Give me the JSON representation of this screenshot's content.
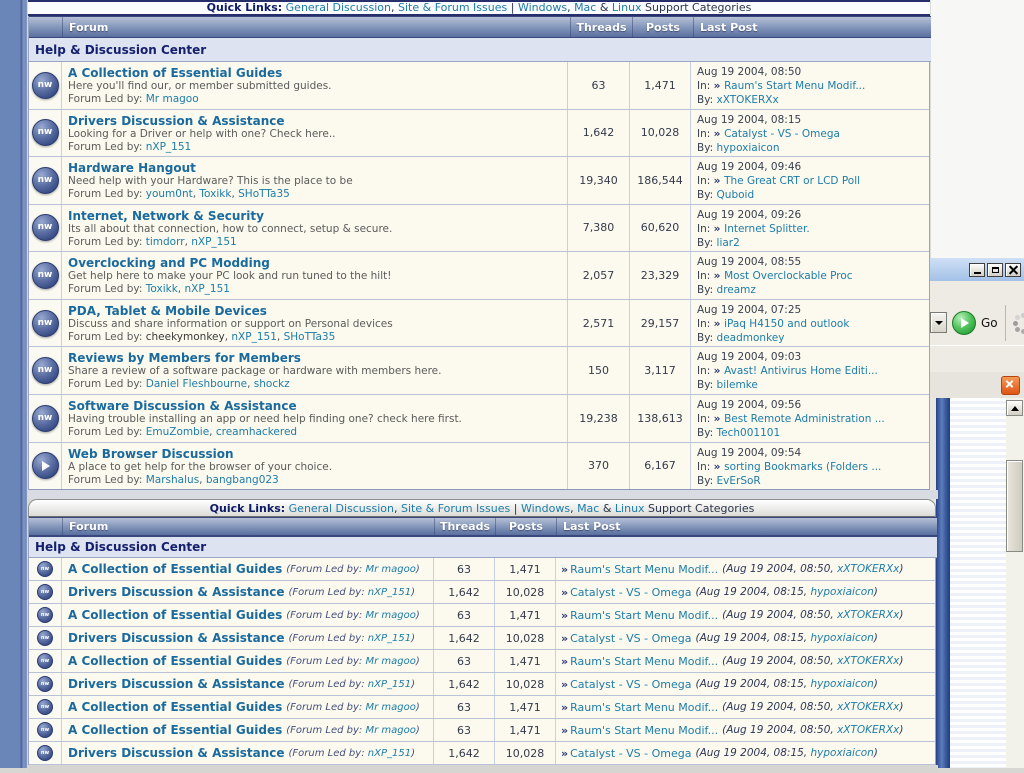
{
  "colors": {
    "title_link": "#1a6a9e",
    "link": "#1d7ca8",
    "category_text": "#141f6e",
    "row_bg": "#fcfaef",
    "left_strip": "#6a85b7",
    "header_gradient_bottom": "#5a6f9f",
    "titlebar": "#a3c1e6",
    "go_green": "#2da23c",
    "orange_close": "#dd5415",
    "blue_bar": "#24418a"
  },
  "quick_links": {
    "label": "Quick Links:",
    "link_general": "General Discussion",
    "sep1": ", ",
    "link_site": "Site & Forum Issues",
    "sep2": " | ",
    "link_windows": "Windows",
    "sep3": ", ",
    "link_mac": "Mac",
    "sep4": " & ",
    "link_linux": "Linux",
    "suffix": " Support Categories"
  },
  "labels": {
    "icon_text": "nw",
    "led_by": "Forum Led by: ",
    "in_label": "In: ",
    "by_label": "By: ",
    "arrow": "»",
    "led_open": "(Forum Led by: ",
    "led_close": ")",
    "paren_open": "(",
    "paren_close": ")"
  },
  "table1": {
    "headers": {
      "forum": "Forum",
      "threads": "Threads",
      "posts": "Posts",
      "last_post": "Last Post"
    },
    "category": "Help & Discussion Center",
    "rows": [
      {
        "icon": "nw",
        "title": "A Collection of Essential Guides",
        "desc": "Here you'll find our, or member submitted guides.",
        "leaders": [
          {
            "name": "Mr magoo",
            "link": true
          }
        ],
        "threads": "63",
        "posts": "1,471",
        "date": "Aug 19 2004, 08:50",
        "topic": "Raum's Start Menu Modif...",
        "user": "xXTOKERXx"
      },
      {
        "icon": "nw",
        "title": "Drivers Discussion & Assistance",
        "desc": "Looking for a Driver or help with one? Check here..",
        "leaders": [
          {
            "name": "nXP_151",
            "link": true
          }
        ],
        "threads": "1,642",
        "posts": "10,028",
        "date": "Aug 19 2004, 08:15",
        "topic": "Catalyst - VS - Omega",
        "user": "hypoxiaicon"
      },
      {
        "icon": "nw",
        "title": "Hardware Hangout",
        "desc": "Need help with your Hardware? This is the place to be",
        "leaders": [
          {
            "name": "youm0nt",
            "link": true
          },
          {
            "name": "Toxikk",
            "link": true
          },
          {
            "name": "SHoTTa35",
            "link": true
          }
        ],
        "threads": "19,340",
        "posts": "186,544",
        "date": "Aug 19 2004, 09:46",
        "topic": "The Great CRT or LCD Poll",
        "user": "Quboid"
      },
      {
        "icon": "nw",
        "title": "Internet, Network & Security",
        "desc": "Its all about that connection, how to connect, setup & secure.",
        "leaders": [
          {
            "name": "timdorr",
            "link": true
          },
          {
            "name": "nXP_151",
            "link": true
          }
        ],
        "threads": "7,380",
        "posts": "60,620",
        "date": "Aug 19 2004, 09:26",
        "topic": "Internet Splitter.",
        "user": "liar2"
      },
      {
        "icon": "nw",
        "title": "Overclocking and PC Modding",
        "desc": "Get help here to make your PC look and run tuned to the hilt!",
        "leaders": [
          {
            "name": "Toxikk",
            "link": true
          },
          {
            "name": "nXP_151",
            "link": true
          }
        ],
        "threads": "2,057",
        "posts": "23,329",
        "date": "Aug 19 2004, 08:55",
        "topic": "Most Overclockable Proc",
        "user": "dreamz"
      },
      {
        "icon": "nw",
        "title": "PDA, Tablet & Mobile Devices",
        "desc": "Discuss and share information or support on Personal devices",
        "leaders": [
          {
            "name": "cheekymonkey",
            "link": false
          },
          {
            "name": "nXP_151",
            "link": true
          },
          {
            "name": "SHoTTa35",
            "link": true
          }
        ],
        "threads": "2,571",
        "posts": "29,157",
        "date": "Aug 19 2004, 07:25",
        "topic": "iPaq H4150 and outlook",
        "user": "deadmonkey"
      },
      {
        "icon": "nw",
        "title": "Reviews by Members for Members",
        "desc": "Share a review of a software package or hardware with members here.",
        "leaders": [
          {
            "name": "Daniel Fleshbourne",
            "link": true
          },
          {
            "name": "shockz",
            "link": true
          }
        ],
        "threads": "150",
        "posts": "3,117",
        "date": "Aug 19 2004, 09:03",
        "topic": "Avast! Antivirus Home Editi...",
        "user": "bilemke"
      },
      {
        "icon": "nw",
        "title": "Software Discussion & Assistance",
        "desc": "Having trouble installing an app or need help finding one? check here first.",
        "leaders": [
          {
            "name": "EmuZombie",
            "link": true
          },
          {
            "name": "creamhackered",
            "link": true
          }
        ],
        "threads": "19,238",
        "posts": "138,613",
        "date": "Aug 19 2004, 09:56",
        "topic": "Best Remote Administration ...",
        "user": "Tech001101"
      },
      {
        "icon": "arrow",
        "title": "Web Browser Discussion",
        "desc": "A place to get help for the browser of your choice.",
        "leaders": [
          {
            "name": "Marshalus",
            "link": true
          },
          {
            "name": "bangbang023",
            "link": true
          }
        ],
        "threads": "370",
        "posts": "6,167",
        "date": "Aug 19 2004, 09:54",
        "topic": "sorting Bookmarks (Folders ...",
        "user": "EvErSoR"
      }
    ]
  },
  "table2": {
    "headers": {
      "forum": "Forum",
      "threads": "Threads",
      "posts": "Posts",
      "last_post": "Last Post"
    },
    "category": "Help & Discussion Center",
    "rows": [
      {
        "icon": "nw",
        "title": "A Collection of Essential Guides",
        "led": "Mr magoo",
        "threads": "63",
        "posts": "1,471",
        "topic": "Raum's Start Menu Modif...",
        "meta_date": "Aug 19 2004, 08:50,",
        "user": "xXTOKERXx"
      },
      {
        "icon": "nw",
        "title": "Drivers Discussion & Assistance",
        "led": "nXP_151",
        "threads": "1,642",
        "posts": "10,028",
        "topic": "Catalyst - VS - Omega",
        "meta_date": "Aug 19 2004, 08:15,",
        "user": "hypoxiaicon"
      },
      {
        "icon": "nw",
        "title": "A Collection of Essential Guides",
        "led": "Mr magoo",
        "threads": "63",
        "posts": "1,471",
        "topic": "Raum's Start Menu Modif...",
        "meta_date": "Aug 19 2004, 08:50,",
        "user": "xXTOKERXx"
      },
      {
        "icon": "nw",
        "title": "Drivers Discussion & Assistance",
        "led": "nXP_151",
        "threads": "1,642",
        "posts": "10,028",
        "topic": "Catalyst - VS - Omega",
        "meta_date": "Aug 19 2004, 08:15,",
        "user": "hypoxiaicon"
      },
      {
        "icon": "nw",
        "title": "A Collection of Essential Guides",
        "led": "Mr magoo",
        "threads": "63",
        "posts": "1,471",
        "topic": "Raum's Start Menu Modif...",
        "meta_date": "Aug 19 2004, 08:50,",
        "user": "xXTOKERXx"
      },
      {
        "icon": "nw",
        "title": "Drivers Discussion & Assistance",
        "led": "nXP_151",
        "threads": "1,642",
        "posts": "10,028",
        "topic": "Catalyst - VS - Omega",
        "meta_date": "Aug 19 2004, 08:15,",
        "user": "hypoxiaicon"
      },
      {
        "icon": "nw",
        "title": "A Collection of Essential Guides",
        "led": "Mr magoo",
        "threads": "63",
        "posts": "1,471",
        "topic": "Raum's Start Menu Modif...",
        "meta_date": "Aug 19 2004, 08:50,",
        "user": "xXTOKERXx"
      },
      {
        "icon": "nw",
        "title": "A Collection of Essential Guides",
        "led": "Mr magoo",
        "threads": "63",
        "posts": "1,471",
        "topic": "Raum's Start Menu Modif...",
        "meta_date": "Aug 19 2004, 08:50,",
        "user": "xXTOKERXx"
      },
      {
        "icon": "nw",
        "title": "Drivers Discussion & Assistance",
        "led": "nXP_151",
        "threads": "1,642",
        "posts": "10,028",
        "topic": "Catalyst - VS - Omega",
        "meta_date": "Aug 19 2004, 08:15,",
        "user": "hypoxiaicon"
      }
    ]
  },
  "side_window": {
    "go_label": "Go"
  }
}
